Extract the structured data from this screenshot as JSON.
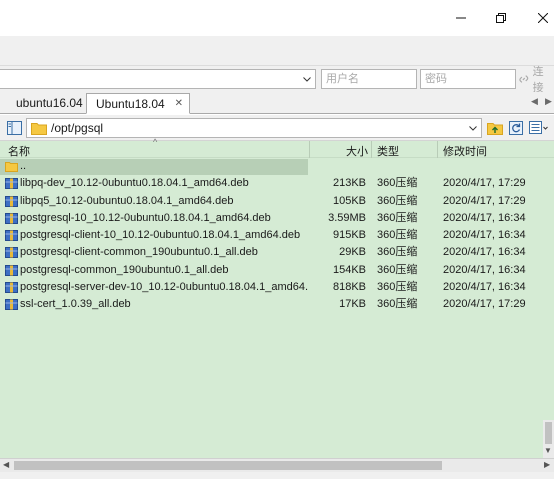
{
  "connection": {
    "username_placeholder": "用户名",
    "password_placeholder": "密码",
    "connect_label": "连接"
  },
  "tabs": [
    {
      "label": "ubuntu16.04",
      "active": false
    },
    {
      "label": "Ubuntu18.04",
      "active": true,
      "close": "✕"
    }
  ],
  "path": {
    "value": "/opt/pgsql"
  },
  "columns": {
    "name": "名称",
    "size": "大小",
    "type": "类型",
    "modified": "修改时间"
  },
  "parent_dir": "..",
  "files": [
    {
      "name": "libpq-dev_10.12-0ubuntu0.18.04.1_amd64.deb",
      "size": "213KB",
      "type": "360压缩",
      "modified": "2020/4/17, 17:29"
    },
    {
      "name": "libpq5_10.12-0ubuntu0.18.04.1_amd64.deb",
      "size": "105KB",
      "type": "360压缩",
      "modified": "2020/4/17, 17:29"
    },
    {
      "name": "postgresql-10_10.12-0ubuntu0.18.04.1_amd64.deb",
      "size": "3.59MB",
      "type": "360压缩",
      "modified": "2020/4/17, 16:34"
    },
    {
      "name": "postgresql-client-10_10.12-0ubuntu0.18.04.1_amd64.deb",
      "size": "915KB",
      "type": "360压缩",
      "modified": "2020/4/17, 16:34"
    },
    {
      "name": "postgresql-client-common_190ubuntu0.1_all.deb",
      "size": "29KB",
      "type": "360压缩",
      "modified": "2020/4/17, 16:34"
    },
    {
      "name": "postgresql-common_190ubuntu0.1_all.deb",
      "size": "154KB",
      "type": "360压缩",
      "modified": "2020/4/17, 16:34"
    },
    {
      "name": "postgresql-server-dev-10_10.12-0ubuntu0.18.04.1_amd64....",
      "size": "818KB",
      "type": "360压缩",
      "modified": "2020/4/17, 16:34"
    },
    {
      "name": "ssl-cert_1.0.39_all.deb",
      "size": "17KB",
      "type": "360压缩",
      "modified": "2020/4/17, 17:29"
    }
  ],
  "colors": {
    "list_background": "#d5ebd4",
    "selected_row": "#b7cfb6",
    "folder_yellow": "#f5c842"
  }
}
